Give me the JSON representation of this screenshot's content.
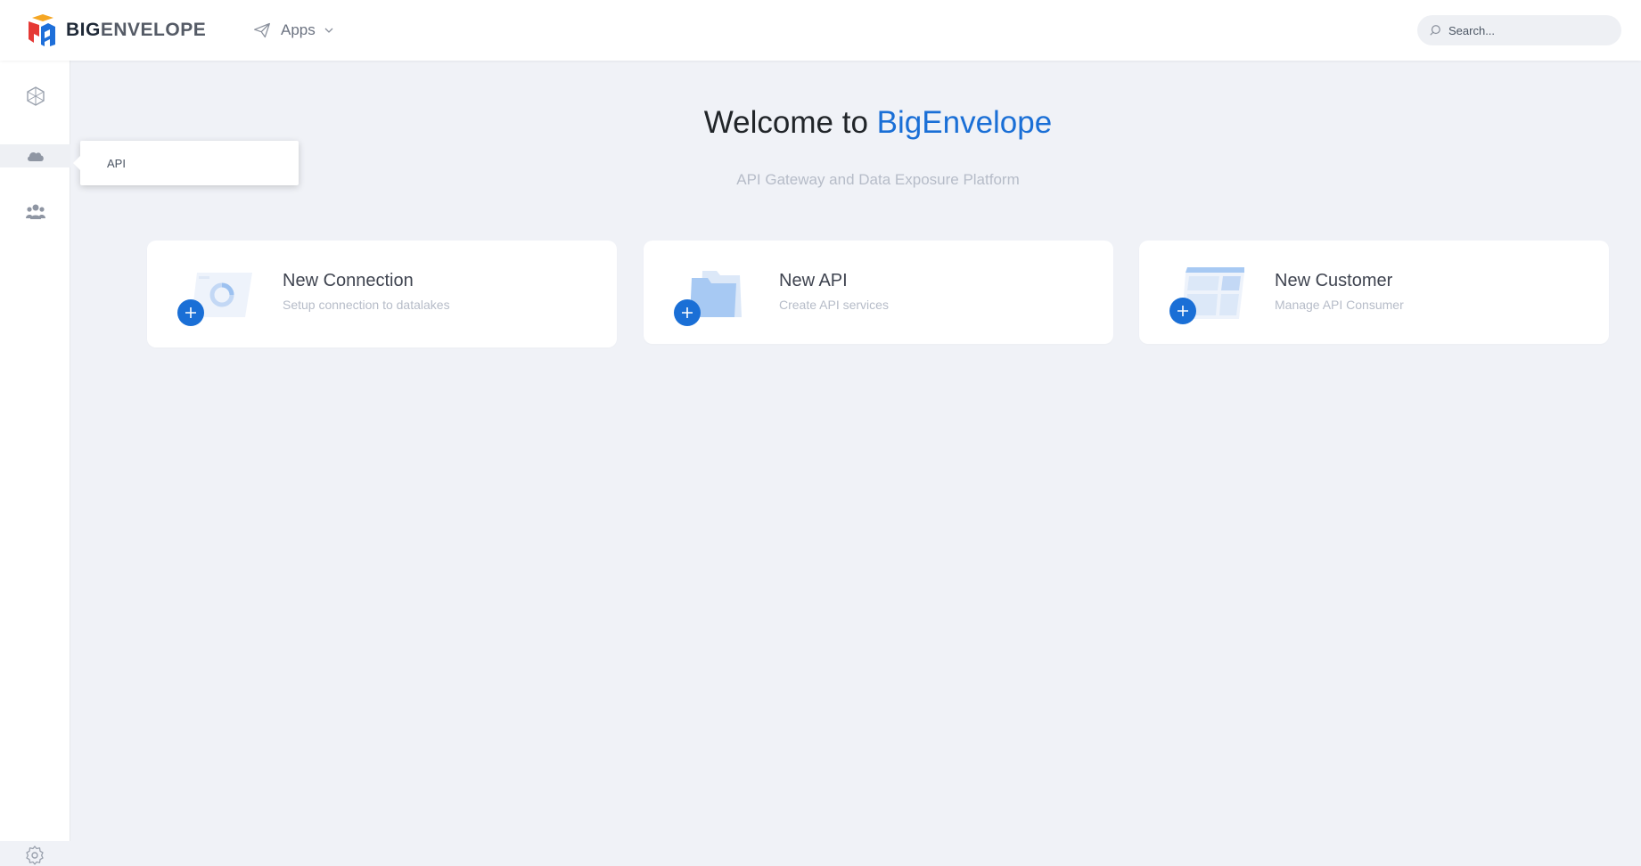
{
  "header": {
    "logo_bold": "BIG",
    "logo_rest": "ENVELOPE",
    "apps_label": "Apps",
    "search_placeholder": "Search..."
  },
  "sidebar": {
    "items": [
      {
        "name": "dashboard",
        "icon": "hexagon-network-icon"
      },
      {
        "name": "api",
        "icon": "cloud-icon",
        "active": true
      },
      {
        "name": "customers",
        "icon": "users-icon"
      }
    ],
    "settings_icon": "gear-icon"
  },
  "tooltip": {
    "label": "API"
  },
  "main": {
    "welcome_prefix": "Welcome to",
    "welcome_brand": "BigEnvelope",
    "subtitle": "API Gateway and Data Exposure Platform",
    "cards": [
      {
        "title": "New Connection",
        "desc": "Setup connection to datalakes"
      },
      {
        "title": "New API",
        "desc": "Create API services"
      },
      {
        "title": "New Customer",
        "desc": "Manage API Consumer"
      }
    ]
  },
  "colors": {
    "accent": "#1a6fd6",
    "background": "#f0f2f7",
    "card": "#ffffff",
    "muted_text": "#b6bcc8"
  }
}
